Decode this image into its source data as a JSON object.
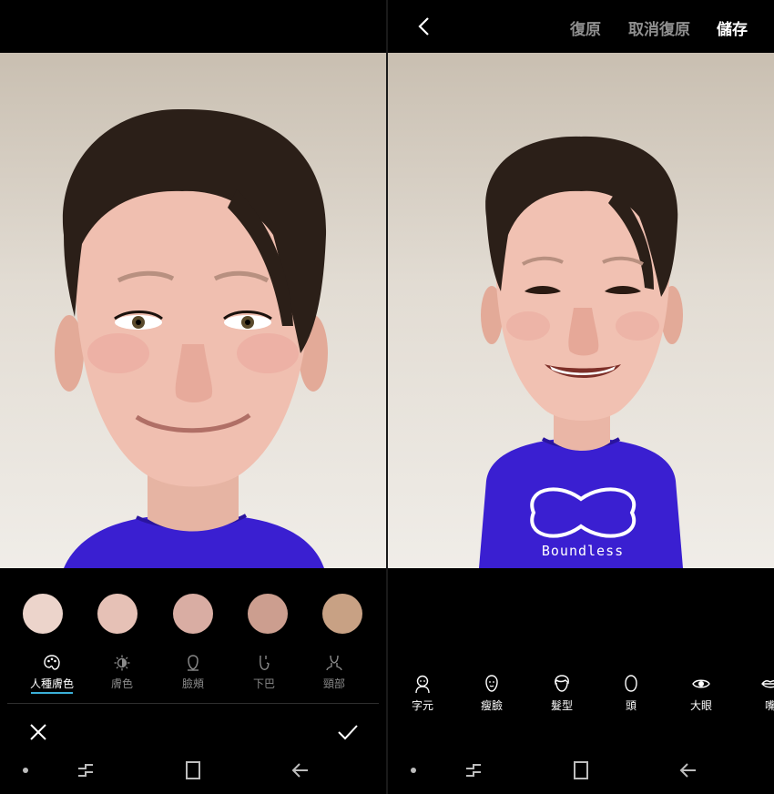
{
  "left_panel": {
    "skin_swatches": [
      {
        "name": "skin-tone-1",
        "color": "#ecd4cb"
      },
      {
        "name": "skin-tone-2",
        "color": "#e6c1b6"
      },
      {
        "name": "skin-tone-3",
        "color": "#d9ada3"
      },
      {
        "name": "skin-tone-4",
        "color": "#cc9e8f"
      },
      {
        "name": "skin-tone-5",
        "color": "#c8a184"
      }
    ],
    "categories": [
      {
        "label": "人種膚色",
        "icon": "palette-icon",
        "active": true
      },
      {
        "label": "膚色",
        "icon": "brightness-icon",
        "active": false
      },
      {
        "label": "臉頰",
        "icon": "face-outline-icon",
        "active": false
      },
      {
        "label": "下巴",
        "icon": "chin-icon",
        "active": false
      },
      {
        "label": "頸部",
        "icon": "neck-icon",
        "active": false
      }
    ],
    "accent_color": "#3bb0d8"
  },
  "right_panel": {
    "top_actions": {
      "restore": "復原",
      "undo": "取消復原",
      "save": "儲存"
    },
    "shirt_print": "Boundless",
    "features": [
      {
        "label": "字元",
        "icon": "character-icon"
      },
      {
        "label": "瘦臉",
        "icon": "slim-face-icon"
      },
      {
        "label": "髮型",
        "icon": "hairstyle-icon"
      },
      {
        "label": "頭",
        "icon": "head-icon"
      },
      {
        "label": "大眼",
        "icon": "eye-icon"
      },
      {
        "label": "嘴",
        "icon": "lips-icon"
      }
    ]
  }
}
